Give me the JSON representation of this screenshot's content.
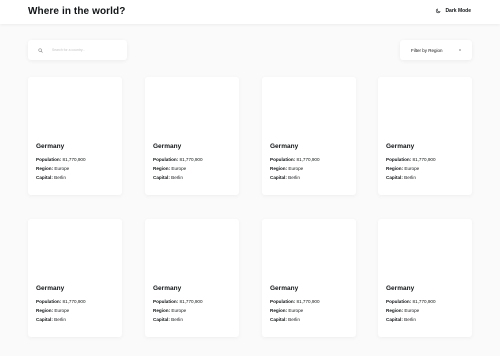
{
  "header": {
    "title": "Where in the world?",
    "mode_label": "Dark Mode"
  },
  "search": {
    "placeholder": "Search for a country..."
  },
  "filter": {
    "label": "Filter by Region"
  },
  "labels": {
    "population": "Population:",
    "region": "Region:",
    "capital": "Capital:"
  },
  "countries": [
    {
      "name": "Germany",
      "population": "81,770,900",
      "region": "Europe",
      "capital": "Berlin"
    },
    {
      "name": "Germany",
      "population": "81,770,900",
      "region": "Europe",
      "capital": "Berlin"
    },
    {
      "name": "Germany",
      "population": "81,770,900",
      "region": "Europe",
      "capital": "Berlin"
    },
    {
      "name": "Germany",
      "population": "81,770,900",
      "region": "Europe",
      "capital": "Berlin"
    },
    {
      "name": "Germany",
      "population": "81,770,900",
      "region": "Europe",
      "capital": "Berlin"
    },
    {
      "name": "Germany",
      "population": "81,770,900",
      "region": "Europe",
      "capital": "Berlin"
    },
    {
      "name": "Germany",
      "population": "81,770,900",
      "region": "Europe",
      "capital": "Berlin"
    },
    {
      "name": "Germany",
      "population": "81,770,900",
      "region": "Europe",
      "capital": "Berlin"
    }
  ],
  "icons": {
    "mode": "moon-icon",
    "search": "search-icon",
    "filter": "chevron-down-icon"
  },
  "colors": {
    "background": "#fafafa",
    "surface": "#ffffff",
    "text": "#111517"
  }
}
